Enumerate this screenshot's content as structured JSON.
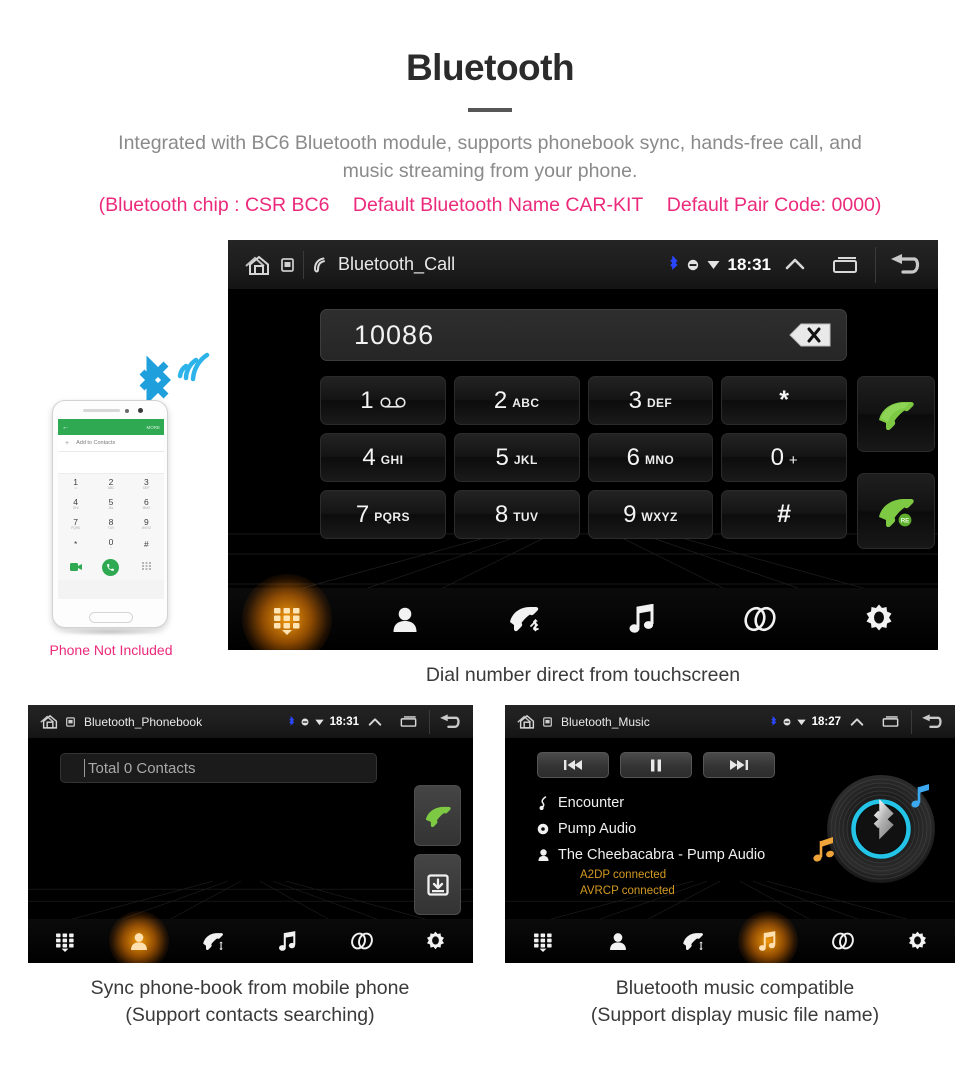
{
  "header": {
    "title": "Bluetooth",
    "subtitle_line1": "Integrated with BC6 Bluetooth module, supports phonebook sync, hands-free call, and",
    "subtitle_line2": "music streaming from your phone.",
    "note_chip": "(Bluetooth chip : CSR BC6",
    "note_name": "Default Bluetooth Name CAR-KIT",
    "note_pair": "Default Pair Code: 0000)",
    "accent_pink": "#ec2a7c",
    "text_gray": "#8a8a8a"
  },
  "dialer_screen": {
    "statusbar": {
      "title": "Bluetooth_Call",
      "time": "18:31",
      "home_icon": "home-icon",
      "sd_icon": "sdcard-icon",
      "call_icon": "phone-handset-icon",
      "bluetooth_icon": "bluetooth-icon",
      "mute_icon": "mute-icon",
      "wifi_icon": "wifi-icon",
      "expand_icon": "chevron-up-icon",
      "recents_icon": "recents-icon",
      "back_icon": "back-arrow-icon"
    },
    "number_value": "10086",
    "backspace_icon": "backspace-icon",
    "keys": [
      {
        "digit": "1",
        "letters": "",
        "glyph": "voicemail-icon",
        "name": "key-1"
      },
      {
        "digit": "2",
        "letters": "ABC",
        "glyph": "",
        "name": "key-2"
      },
      {
        "digit": "3",
        "letters": "DEF",
        "glyph": "",
        "name": "key-3"
      },
      {
        "digit": "*",
        "letters": "",
        "glyph": "",
        "name": "key-star"
      },
      {
        "digit": "4",
        "letters": "GHI",
        "glyph": "",
        "name": "key-4"
      },
      {
        "digit": "5",
        "letters": "JKL",
        "glyph": "",
        "name": "key-5"
      },
      {
        "digit": "6",
        "letters": "MNO",
        "glyph": "",
        "name": "key-6"
      },
      {
        "digit": "0",
        "letters": "+",
        "glyph": "",
        "name": "key-0"
      },
      {
        "digit": "7",
        "letters": "PQRS",
        "glyph": "",
        "name": "key-7"
      },
      {
        "digit": "8",
        "letters": "TUV",
        "glyph": "",
        "name": "key-8"
      },
      {
        "digit": "9",
        "letters": "WXYZ",
        "glyph": "",
        "name": "key-9"
      },
      {
        "digit": "#",
        "letters": "",
        "glyph": "",
        "name": "key-hash"
      }
    ],
    "call_button_icon": "call-green-icon",
    "redial_button_icon": "redial-green-icon",
    "redial_badge": "RE",
    "navbar": [
      {
        "name": "nav-keypad",
        "icon": "keypad-icon",
        "active": true
      },
      {
        "name": "nav-contacts",
        "icon": "contact-icon",
        "active": false
      },
      {
        "name": "nav-calllog",
        "icon": "call-log-icon",
        "active": false
      },
      {
        "name": "nav-music",
        "icon": "music-note-icon",
        "active": false
      },
      {
        "name": "nav-link",
        "icon": "link-icon",
        "active": false
      },
      {
        "name": "nav-settings",
        "icon": "gear-icon",
        "active": false
      }
    ],
    "active_color": "#ffa00a"
  },
  "phonebook_screen": {
    "statusbar": {
      "title": "Bluetooth_Phonebook",
      "time": "18:31"
    },
    "search_placeholder": "Total 0 Contacts",
    "side_buttons": [
      {
        "name": "phonebook-call-button",
        "icon": "call-green-icon"
      },
      {
        "name": "phonebook-download-button",
        "icon": "download-tray-icon"
      }
    ],
    "navbar": [
      {
        "name": "nav-keypad",
        "icon": "keypad-icon",
        "active": false
      },
      {
        "name": "nav-contacts",
        "icon": "contact-icon",
        "active": true
      },
      {
        "name": "nav-calllog",
        "icon": "call-log-icon",
        "active": false
      },
      {
        "name": "nav-music",
        "icon": "music-note-icon",
        "active": false
      },
      {
        "name": "nav-link",
        "icon": "link-icon",
        "active": false
      },
      {
        "name": "nav-settings",
        "icon": "gear-icon",
        "active": false
      }
    ]
  },
  "music_screen": {
    "statusbar": {
      "title": "Bluetooth_Music",
      "time": "18:27"
    },
    "controls": [
      {
        "name": "previous-track-button",
        "icon": "skip-back-icon"
      },
      {
        "name": "pause-button",
        "icon": "pause-icon"
      },
      {
        "name": "next-track-button",
        "icon": "skip-forward-icon"
      }
    ],
    "track": {
      "title": "Encounter",
      "album": "Pump Audio",
      "artist": "The Cheebacabra - Pump Audio",
      "title_icon": "note-icon",
      "album_icon": "disc-icon",
      "artist_icon": "person-icon"
    },
    "status_lines": [
      "A2DP connected",
      "AVRCP connected"
    ],
    "status_color": "#d39a22",
    "vinyl_icon": "bluetooth-vinyl-icon",
    "navbar": [
      {
        "name": "nav-keypad",
        "icon": "keypad-icon",
        "active": false
      },
      {
        "name": "nav-contacts",
        "icon": "contact-icon",
        "active": false
      },
      {
        "name": "nav-calllog",
        "icon": "call-log-icon",
        "active": false
      },
      {
        "name": "nav-music",
        "icon": "music-note-icon",
        "active": true
      },
      {
        "name": "nav-link",
        "icon": "link-icon",
        "active": false
      },
      {
        "name": "nav-settings",
        "icon": "gear-icon",
        "active": false
      }
    ]
  },
  "phone_mock": {
    "header_back": "←",
    "header_more": "MORE",
    "add_contact": "Add to Contacts",
    "keys": [
      {
        "n": "1",
        "s": "∞"
      },
      {
        "n": "2",
        "s": "ABC"
      },
      {
        "n": "3",
        "s": "DEF"
      },
      {
        "n": "4",
        "s": "GHI"
      },
      {
        "n": "5",
        "s": "JKL"
      },
      {
        "n": "6",
        "s": "MNO"
      },
      {
        "n": "7",
        "s": "PQRS"
      },
      {
        "n": "8",
        "s": "TUV"
      },
      {
        "n": "9",
        "s": "WXYZ"
      },
      {
        "n": "*",
        "s": ""
      },
      {
        "n": "0",
        "s": "+"
      },
      {
        "n": "#",
        "s": ""
      }
    ],
    "not_included_label": "Phone Not Included",
    "bluetooth_badge_icon": "bluetooth-signal-icon",
    "badge_color": "#21a3e0"
  },
  "captions": {
    "dialer": "Dial number direct from touchscreen",
    "phonebook_line1": "Sync phone-book from mobile phone",
    "phonebook_line2": "(Support contacts searching)",
    "music_line1": "Bluetooth music compatible",
    "music_line2": "(Support display music file name)"
  }
}
